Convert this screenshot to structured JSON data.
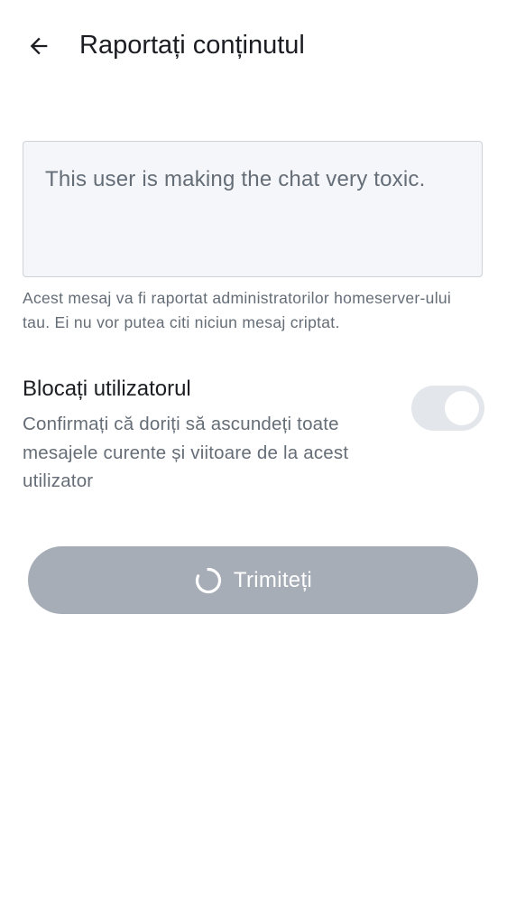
{
  "header": {
    "back_icon": "arrow-left-icon",
    "title": "Raportați conținutul"
  },
  "reason": {
    "value": "This user is making the chat very toxic.",
    "helper": "Acest mesaj va fi raportat administratorilor homeserver-ului tau. Ei nu vor putea citi niciun mesaj criptat."
  },
  "block_user": {
    "title": "Blocați utilizatorul",
    "description": "Confirmați că doriți să ascundeți toate mesajele curente și viitoare de la acest utilizator",
    "enabled": false,
    "toggle_state": "on"
  },
  "submit": {
    "label": "Trimiteți",
    "loading": true,
    "spinner_icon": "loading-spinner-icon"
  },
  "colors": {
    "text_primary": "#1b1d22",
    "text_secondary": "#656d77",
    "field_background": "#f4f6fa",
    "field_border": "#cdd3da",
    "button_disabled": "#a7adb7",
    "toggle_track_disabled": "#e3e6ea"
  }
}
